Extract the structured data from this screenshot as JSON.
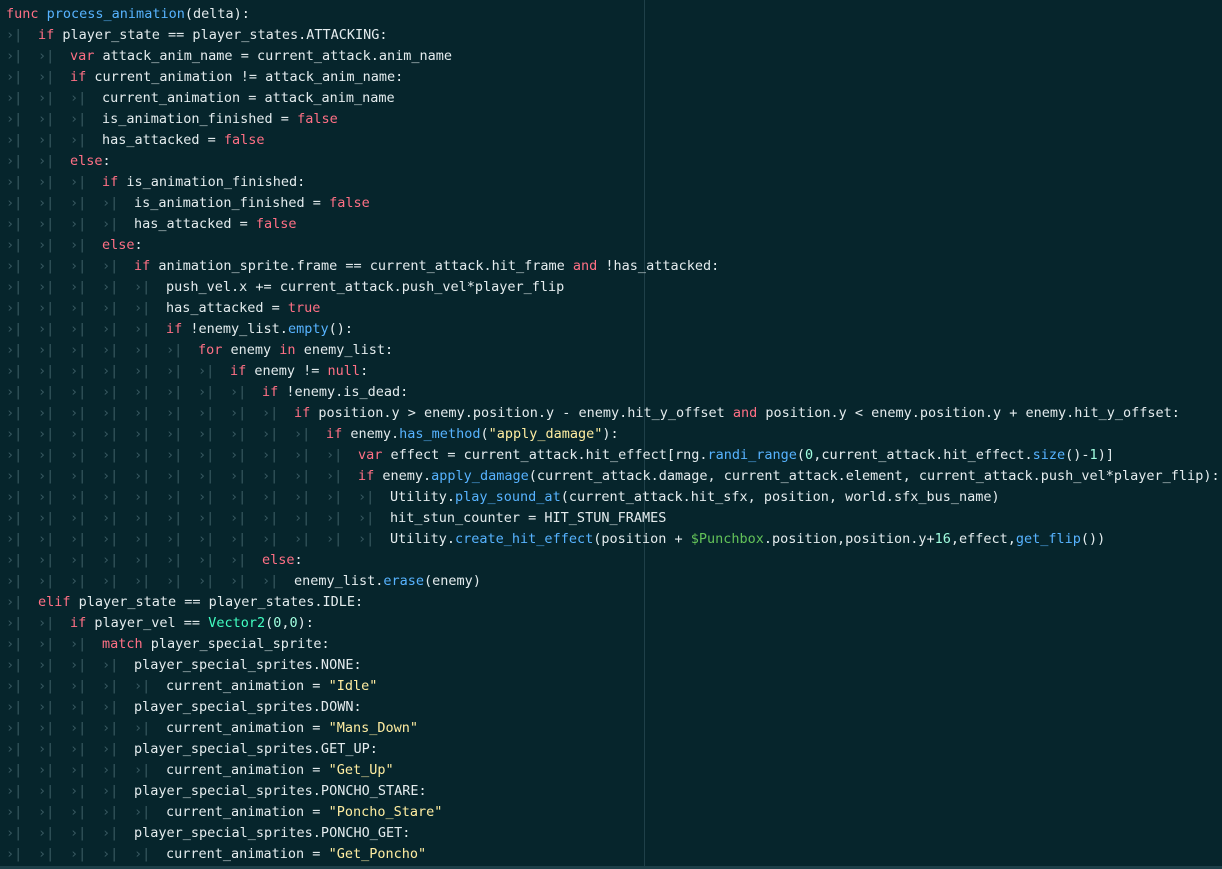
{
  "editor": {
    "tab_glyph": "›|",
    "lines": [
      {
        "indent": 0,
        "tokens": [
          {
            "t": "func",
            "c": "kw"
          },
          {
            "t": " "
          },
          {
            "t": "process_animation",
            "c": "fn"
          },
          {
            "t": "(delta):"
          }
        ]
      },
      {
        "indent": 1,
        "tokens": [
          {
            "t": "if",
            "c": "kw"
          },
          {
            "t": " player_state == player_states.ATTACKING:"
          }
        ]
      },
      {
        "indent": 2,
        "tokens": [
          {
            "t": "var",
            "c": "kw"
          },
          {
            "t": " attack_anim_name = current_attack.anim_name"
          }
        ]
      },
      {
        "indent": 2,
        "tokens": [
          {
            "t": "if",
            "c": "kw"
          },
          {
            "t": " current_animation != attack_anim_name:"
          }
        ]
      },
      {
        "indent": 3,
        "tokens": [
          {
            "t": "current_animation = attack_anim_name"
          }
        ]
      },
      {
        "indent": 3,
        "tokens": [
          {
            "t": "is_animation_finished = "
          },
          {
            "t": "false",
            "c": "kw"
          }
        ]
      },
      {
        "indent": 3,
        "tokens": [
          {
            "t": "has_attacked = "
          },
          {
            "t": "false",
            "c": "kw"
          }
        ]
      },
      {
        "indent": 2,
        "tokens": [
          {
            "t": "else",
            "c": "kw"
          },
          {
            "t": ":"
          }
        ]
      },
      {
        "indent": 3,
        "tokens": [
          {
            "t": "if",
            "c": "kw"
          },
          {
            "t": " is_animation_finished:"
          }
        ]
      },
      {
        "indent": 4,
        "tokens": [
          {
            "t": "is_animation_finished = "
          },
          {
            "t": "false",
            "c": "kw"
          }
        ]
      },
      {
        "indent": 4,
        "tokens": [
          {
            "t": "has_attacked = "
          },
          {
            "t": "false",
            "c": "kw"
          }
        ]
      },
      {
        "indent": 3,
        "tokens": [
          {
            "t": "else",
            "c": "kw"
          },
          {
            "t": ":"
          }
        ]
      },
      {
        "indent": 4,
        "tokens": [
          {
            "t": "if",
            "c": "kw"
          },
          {
            "t": " animation_sprite.frame == current_attack.hit_frame "
          },
          {
            "t": "and",
            "c": "kw"
          },
          {
            "t": " !has_attacked:"
          }
        ]
      },
      {
        "indent": 5,
        "tokens": [
          {
            "t": "push_vel.x += current_attack.push_vel*player_flip"
          }
        ]
      },
      {
        "indent": 5,
        "tokens": [
          {
            "t": "has_attacked = "
          },
          {
            "t": "true",
            "c": "kw"
          }
        ]
      },
      {
        "indent": 5,
        "tokens": [
          {
            "t": "if",
            "c": "kw"
          },
          {
            "t": " !enemy_list."
          },
          {
            "t": "empty",
            "c": "fn"
          },
          {
            "t": "():"
          }
        ]
      },
      {
        "indent": 6,
        "tokens": [
          {
            "t": "for",
            "c": "kw"
          },
          {
            "t": " enemy "
          },
          {
            "t": "in",
            "c": "kw"
          },
          {
            "t": " enemy_list:"
          }
        ]
      },
      {
        "indent": 7,
        "tokens": [
          {
            "t": "if",
            "c": "kw"
          },
          {
            "t": " enemy != "
          },
          {
            "t": "null",
            "c": "kw"
          },
          {
            "t": ":"
          }
        ]
      },
      {
        "indent": 8,
        "tokens": [
          {
            "t": "if",
            "c": "kw"
          },
          {
            "t": " !enemy.is_dead:"
          }
        ]
      },
      {
        "indent": 9,
        "tokens": [
          {
            "t": "if",
            "c": "kw"
          },
          {
            "t": " position.y > enemy.position.y - enemy.hit_y_offset "
          },
          {
            "t": "and",
            "c": "kw"
          },
          {
            "t": " position.y < enemy.position.y + enemy.hit_y_offset:"
          }
        ]
      },
      {
        "indent": 10,
        "tokens": [
          {
            "t": "if",
            "c": "kw"
          },
          {
            "t": " enemy."
          },
          {
            "t": "has_method",
            "c": "fn"
          },
          {
            "t": "("
          },
          {
            "t": "\"apply_damage\"",
            "c": "str"
          },
          {
            "t": "):"
          }
        ]
      },
      {
        "indent": 11,
        "tokens": [
          {
            "t": "var",
            "c": "kw"
          },
          {
            "t": " effect = current_attack.hit_effect[rng."
          },
          {
            "t": "randi_range",
            "c": "fn"
          },
          {
            "t": "("
          },
          {
            "t": "0",
            "c": "num"
          },
          {
            "t": ",current_attack.hit_effect."
          },
          {
            "t": "size",
            "c": "fn"
          },
          {
            "t": "()-"
          },
          {
            "t": "1",
            "c": "num"
          },
          {
            "t": ")]"
          }
        ]
      },
      {
        "indent": 11,
        "tokens": [
          {
            "t": "if",
            "c": "kw"
          },
          {
            "t": " enemy."
          },
          {
            "t": "apply_damage",
            "c": "fn"
          },
          {
            "t": "(current_attack.damage, current_attack.element, current_attack.push_vel*player_flip):"
          }
        ]
      },
      {
        "indent": 12,
        "tokens": [
          {
            "t": "Utility."
          },
          {
            "t": "play_sound_at",
            "c": "fn"
          },
          {
            "t": "(current_attack.hit_sfx, position, world.sfx_bus_name)"
          }
        ]
      },
      {
        "indent": 12,
        "tokens": [
          {
            "t": "hit_stun_counter = HIT_STUN_FRAMES"
          }
        ]
      },
      {
        "indent": 12,
        "tokens": [
          {
            "t": "Utility."
          },
          {
            "t": "create_hit_effect",
            "c": "fn"
          },
          {
            "t": "(position + "
          },
          {
            "t": "$Punchbox",
            "c": "node"
          },
          {
            "t": ".position,position.y+"
          },
          {
            "t": "16",
            "c": "num"
          },
          {
            "t": ",effect,"
          },
          {
            "t": "get_flip",
            "c": "fn"
          },
          {
            "t": "())"
          }
        ]
      },
      {
        "indent": 8,
        "tokens": [
          {
            "t": "else",
            "c": "kw"
          },
          {
            "t": ":"
          }
        ]
      },
      {
        "indent": 9,
        "tokens": [
          {
            "t": "enemy_list."
          },
          {
            "t": "erase",
            "c": "fn"
          },
          {
            "t": "(enemy)"
          }
        ]
      },
      {
        "indent": 1,
        "tokens": [
          {
            "t": "elif",
            "c": "kw"
          },
          {
            "t": " player_state == player_states.IDLE:"
          }
        ]
      },
      {
        "indent": 2,
        "tokens": [
          {
            "t": "if",
            "c": "kw"
          },
          {
            "t": " player_vel == "
          },
          {
            "t": "Vector2",
            "c": "ty"
          },
          {
            "t": "("
          },
          {
            "t": "0",
            "c": "num"
          },
          {
            "t": ","
          },
          {
            "t": "0",
            "c": "num"
          },
          {
            "t": "):"
          }
        ]
      },
      {
        "indent": 3,
        "tokens": [
          {
            "t": "match",
            "c": "kw"
          },
          {
            "t": " player_special_sprite:"
          }
        ]
      },
      {
        "indent": 4,
        "tokens": [
          {
            "t": "player_special_sprites.NONE:"
          }
        ]
      },
      {
        "indent": 5,
        "tokens": [
          {
            "t": "current_animation = "
          },
          {
            "t": "\"Idle\"",
            "c": "str"
          }
        ]
      },
      {
        "indent": 4,
        "tokens": [
          {
            "t": "player_special_sprites.DOWN:"
          }
        ]
      },
      {
        "indent": 5,
        "tokens": [
          {
            "t": "current_animation = "
          },
          {
            "t": "\"Mans_Down\"",
            "c": "str"
          }
        ]
      },
      {
        "indent": 4,
        "tokens": [
          {
            "t": "player_special_sprites.GET_UP:"
          }
        ]
      },
      {
        "indent": 5,
        "tokens": [
          {
            "t": "current_animation = "
          },
          {
            "t": "\"Get_Up\"",
            "c": "str"
          }
        ]
      },
      {
        "indent": 4,
        "tokens": [
          {
            "t": "player_special_sprites.PONCHO_STARE:"
          }
        ]
      },
      {
        "indent": 5,
        "tokens": [
          {
            "t": "current_animation = "
          },
          {
            "t": "\"Poncho_Stare\"",
            "c": "str"
          }
        ]
      },
      {
        "indent": 4,
        "tokens": [
          {
            "t": "player_special_sprites.PONCHO_GET:"
          }
        ]
      },
      {
        "indent": 5,
        "tokens": [
          {
            "t": "current_animation = "
          },
          {
            "t": "\"Get_Poncho\"",
            "c": "str"
          }
        ]
      }
    ]
  }
}
